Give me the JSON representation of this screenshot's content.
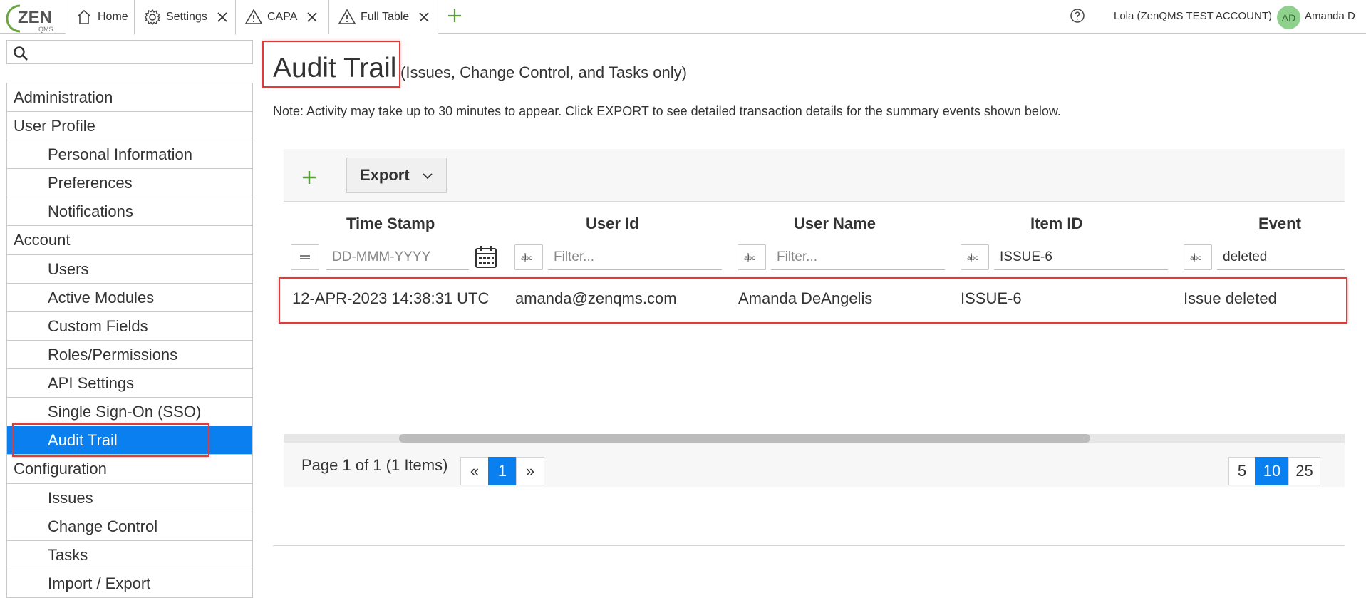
{
  "topbar": {
    "logo_text": "ZEN",
    "logo_subtext": "QMS",
    "tabs": [
      {
        "label": "Home",
        "icon": "home-icon"
      },
      {
        "label": "Settings",
        "icon": "gear-icon"
      },
      {
        "label": "CAPA",
        "icon": "warning-icon"
      },
      {
        "label": "Full Table",
        "icon": "warning-icon"
      }
    ],
    "account": "Lola (ZenQMS TEST ACCOUNT)",
    "avatar_initials": "AD",
    "user_name": "Amanda D",
    "accent_color": "#6aa63f"
  },
  "sidebar": {
    "search_placeholder": "",
    "items": [
      {
        "label": "Administration",
        "level": "section"
      },
      {
        "label": "User Profile",
        "level": "section"
      },
      {
        "label": "Personal Information",
        "level": "sub"
      },
      {
        "label": "Preferences",
        "level": "sub"
      },
      {
        "label": "Notifications",
        "level": "sub"
      },
      {
        "label": "Account",
        "level": "section"
      },
      {
        "label": "Users",
        "level": "sub"
      },
      {
        "label": "Active Modules",
        "level": "sub"
      },
      {
        "label": "Custom Fields",
        "level": "sub"
      },
      {
        "label": "Roles/Permissions",
        "level": "sub"
      },
      {
        "label": "API Settings",
        "level": "sub"
      },
      {
        "label": "Single Sign-On (SSO)",
        "level": "sub"
      },
      {
        "label": "Audit Trail",
        "level": "sub",
        "active": true
      },
      {
        "label": "Configuration",
        "level": "section"
      },
      {
        "label": "Issues",
        "level": "sub"
      },
      {
        "label": "Change Control",
        "level": "sub"
      },
      {
        "label": "Tasks",
        "level": "sub"
      },
      {
        "label": "Import / Export",
        "level": "sub"
      }
    ],
    "active_color": "#0a7ff0"
  },
  "main": {
    "title": "Audit Trail",
    "subtitle": "(Issues, Change Control, and Tasks only)",
    "note": "Note: Activity may take up to 30 minutes to appear. Click EXPORT to see detailed transaction details for the summary events shown below.",
    "export_label": "Export",
    "columns": [
      "Time Stamp",
      "User Id",
      "User Name",
      "Item ID",
      "Event"
    ],
    "filters": {
      "timestamp_placeholder": "DD-MMM-YYYY",
      "userid_placeholder": "Filter...",
      "username_placeholder": "Filter...",
      "itemid_value": "ISSUE-6",
      "event_value": "deleted"
    },
    "rows": [
      {
        "timestamp": "12-APR-2023 14:38:31 UTC",
        "user_id": "amanda@zenqms.com",
        "user_name": "Amanda DeAngelis",
        "item_id": "ISSUE-6",
        "event": "Issue deleted"
      }
    ],
    "pager": {
      "summary": "Page 1 of 1 (1 Items)",
      "prev": "«",
      "current": "1",
      "next": "»",
      "sizes": [
        "5",
        "10",
        "25"
      ],
      "selected_size": "10"
    }
  }
}
